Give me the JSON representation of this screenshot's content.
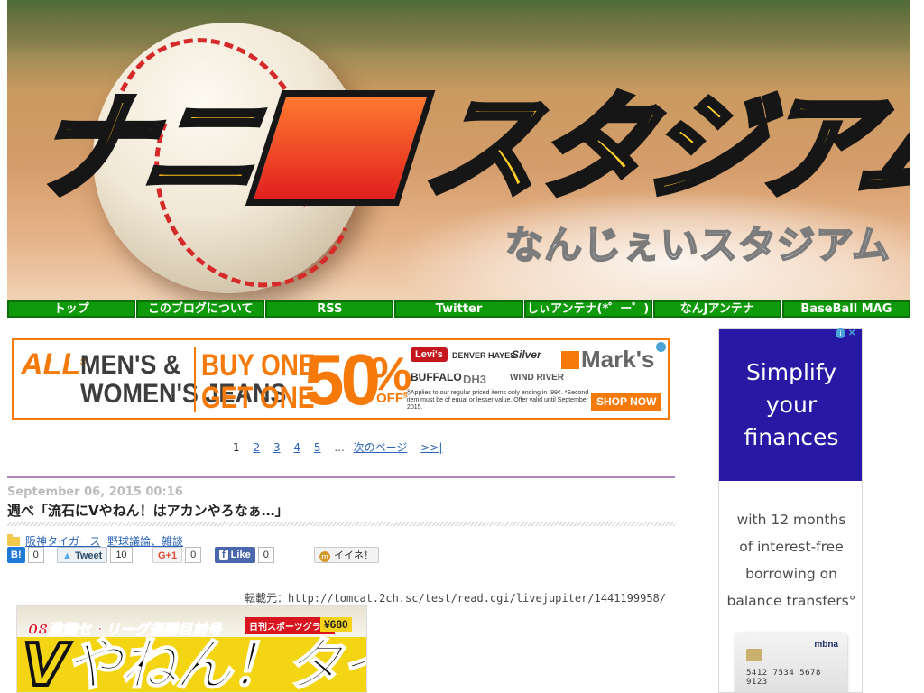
{
  "header": {
    "logo_text": [
      "ナニ",
      "スタジアム"
    ],
    "subtitle": "なんじぇいスタジアム"
  },
  "nav": {
    "items": [
      "トップ",
      "このブログについて",
      "RSS",
      "Twitter",
      "しぃアンテナ(*゜ー゜)",
      "なんJアンテナ",
      "BaseBall MAG"
    ]
  },
  "ad_banner": {
    "brand": "ALL",
    "brand_mark": "§",
    "line1": "MEN'S &",
    "line2": "WOMEN'S JEANS",
    "buy1": "BUY ONE",
    "buy2": "GET ONE",
    "percent": "50",
    "percent_sign": "%",
    "off": "OFF",
    "mark": "§",
    "logos": [
      "Levi's",
      "DENVER HAYES",
      "Silver",
      "BUFFALO",
      "DH3",
      "WIND RIVER"
    ],
    "store": "Mark's",
    "fine_print": "§Applies to our regular priced items only ending in .99¢. *Second item must be of equal or lesser value. Offer valid until September 7, 2015.",
    "cta": "SHOP NOW"
  },
  "pagination": {
    "current": "1",
    "pages": [
      "2",
      "3",
      "4",
      "5"
    ],
    "ellipsis": "...",
    "next": "次のページ",
    "last": ">>|"
  },
  "article": {
    "date": "September 06, 2015 00:16",
    "title": "週べ「流石にVやねん！はアカンやろなぁ…」",
    "categories": [
      "阪神タイガース",
      "野球議論、雑談"
    ],
    "source": "転載元：http://tomcat.2ch.sc/test/read.cgi/livejupiter/1441199958/"
  },
  "social": {
    "hatena": {
      "label": "B!",
      "count": "0"
    },
    "tweet": {
      "label": "Tweet",
      "count": "10"
    },
    "gplus": {
      "label": "G+1",
      "count": "0"
    },
    "facebook": {
      "label": "Like",
      "count": "0"
    },
    "mixi": {
      "label": "イイネ！"
    }
  },
  "magazine": {
    "headline_small": "08激闘セ・リーグ優勝目前号",
    "publisher": "日刊スポーツグラフ",
    "price": "¥680",
    "headline_big_v": "V",
    "headline_big": "やねん！タイガース"
  },
  "side_ad": {
    "headline": [
      "Simplify",
      "your",
      "finances"
    ],
    "body": [
      "with 12 months",
      "of interest-free",
      "borrowing on",
      "balance transfers°"
    ],
    "card": {
      "brand": "mbna",
      "number": "5412 7534 5678 9123"
    }
  },
  "colors": {
    "nav_green": "#0f9a0c",
    "accent_purple": "#b184c4",
    "link_blue": "#2a63b7",
    "ad_orange": "#f57a0a",
    "side_ad_navy": "#2719a4"
  }
}
